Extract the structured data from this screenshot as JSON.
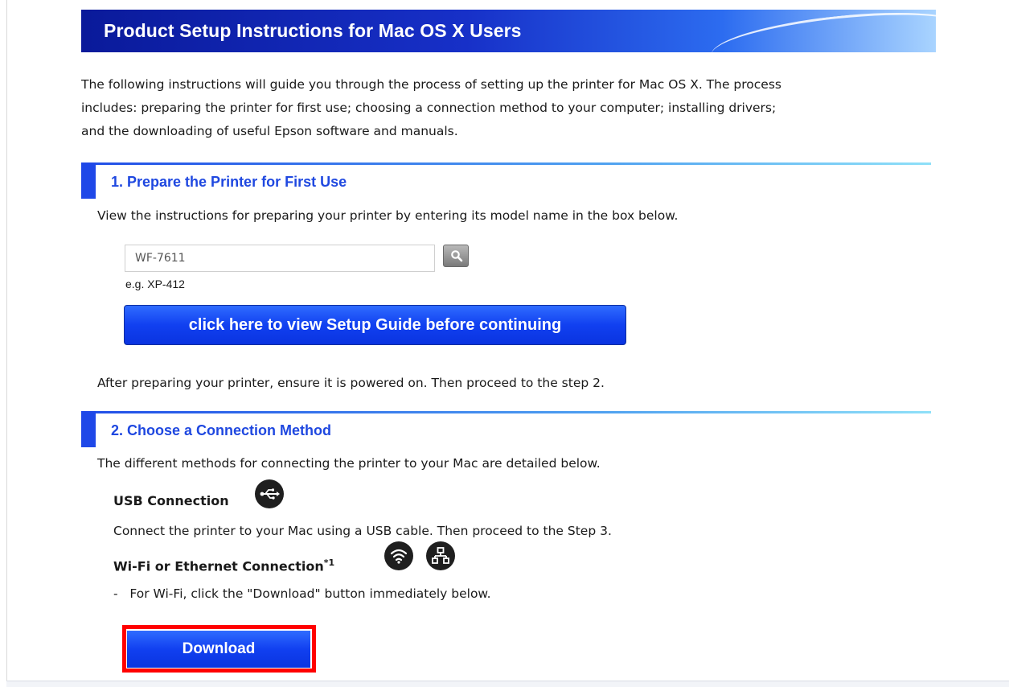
{
  "header": {
    "title": "Product Setup Instructions for Mac OS X Users"
  },
  "intro": {
    "line1": "The following instructions will guide you through the process of setting up the printer for Mac OS X. The process",
    "line2": "includes: preparing the printer for first use; choosing a connection method to your computer; installing drivers;",
    "line3": "and the downloading of useful Epson software and manuals."
  },
  "step1": {
    "title": "1. Prepare the Printer for First Use",
    "description": "View the instructions for preparing your printer by entering its model name in the box below.",
    "model_input_value": "WF-7611",
    "example_text": "e.g. XP-412",
    "guide_button_label": "click here to view Setup Guide before continuing",
    "after_text": "After preparing your printer, ensure it is powered on. Then proceed to the step 2."
  },
  "step2": {
    "title": "2. Choose a Connection Method",
    "description": "The different methods for connecting the printer to your Mac are detailed below.",
    "usb": {
      "heading": "USB Connection",
      "icon": "usb-icon",
      "text": "Connect the printer to your Mac using a USB cable. Then proceed to the Step 3."
    },
    "wifi": {
      "heading": "Wi-Fi or Ethernet Connection",
      "footnote": "*1",
      "icons": [
        "wifi-icon",
        "ethernet-icon"
      ],
      "bullet": "-   For Wi-Fi, click the \"Download\" button immediately below."
    },
    "download_label": "Download"
  },
  "colors": {
    "title_bar_dark": "#0a1a9a",
    "accent_blue": "#1f48e8",
    "button_blue": "#1140f0",
    "highlight_red": "#ff0000"
  }
}
